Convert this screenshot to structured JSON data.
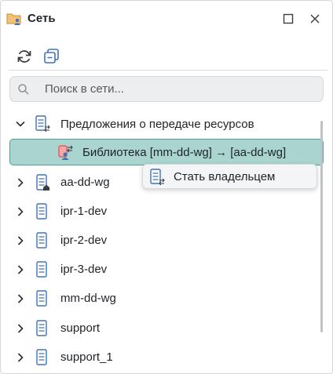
{
  "panel": {
    "title": "Сеть",
    "icon": "folder-network-icon",
    "window_buttons": [
      "maximize-icon",
      "close-icon"
    ]
  },
  "toolbar": {
    "buttons": [
      "refresh-icon",
      "collapse-all-icon"
    ]
  },
  "search": {
    "placeholder": "Поиск в сети...",
    "value": ""
  },
  "tree": {
    "group": {
      "label": "Предложения о передаче ресурсов",
      "expanded": true,
      "child": {
        "label": "Библиотека [mm-dd-wg] → [aa-dd-wg]",
        "selected": true
      }
    },
    "servers": [
      {
        "label": "aa-dd-wg",
        "home": true
      },
      {
        "label": "ipr-1-dev",
        "home": false
      },
      {
        "label": "ipr-2-dev",
        "home": false
      },
      {
        "label": "ipr-3-dev",
        "home": false
      },
      {
        "label": "mm-dd-wg",
        "home": false
      },
      {
        "label": "support",
        "home": false
      },
      {
        "label": "support_1",
        "home": false
      }
    ]
  },
  "context_menu": {
    "items": [
      {
        "label": "Стать владельцем",
        "icon": "server-transfer-icon"
      }
    ]
  },
  "colors": {
    "accent": "#3f73b5",
    "selection_bg": "#a9d4cf",
    "selection_border": "#4f9e97",
    "text": "#1f2328"
  }
}
